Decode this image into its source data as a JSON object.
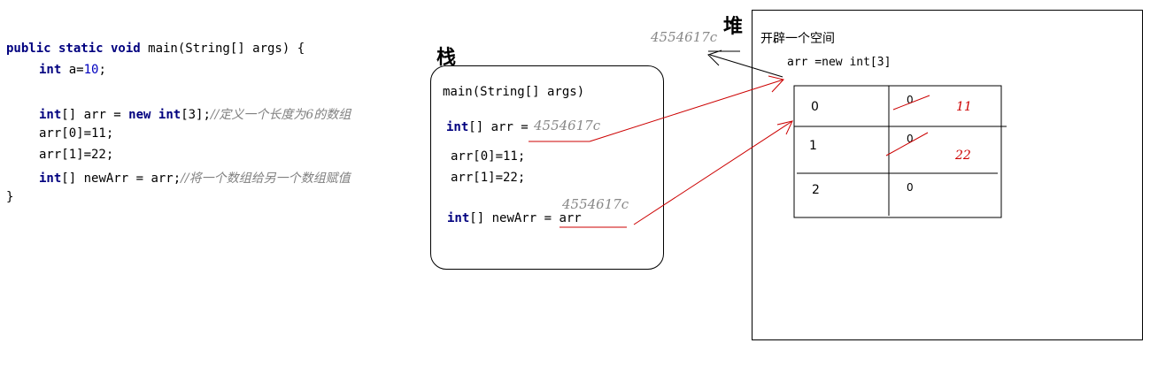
{
  "code": {
    "l1_kw": "public static void",
    "l1_rest": " main(String[] args) {",
    "l2_kw": "int",
    "l2_rest": " a=",
    "l2_num": "10",
    "l2_end": ";",
    "l3_kw1": "int",
    "l3_mid": "[] arr = ",
    "l3_kw2": "new",
    "l3_kw3": "int",
    "l3_idx": "[3];",
    "l3_cmt": "//定义一个长度为6的数组",
    "l4": "arr[0]=11;",
    "l5": "arr[1]=22;",
    "l6_kw": "int",
    "l6_rest": "[] newArr = arr;",
    "l6_cmt": "//将一个数组给另一个数组赋值",
    "l7": "}"
  },
  "stack": {
    "title": "栈",
    "method": "main(String[] args)",
    "arr_kw": "int",
    "arr_rest": "[] arr =",
    "arr_addr": "4554617c",
    "a0": "arr[0]=11;",
    "a1": "arr[1]=22;",
    "new_kw": "int",
    "new_rest": "[] newArr = arr",
    "new_addr": "4554617c"
  },
  "heap": {
    "title": "堆",
    "addr": "4554617c",
    "open_space": "开辟一个空间",
    "new_expr": "arr =new int[3]",
    "rows": [
      {
        "index": "0",
        "old": "0",
        "new": "11"
      },
      {
        "index": "1",
        "old": "0",
        "new": "22"
      },
      {
        "index": "2",
        "old": "0",
        "new": ""
      }
    ]
  }
}
